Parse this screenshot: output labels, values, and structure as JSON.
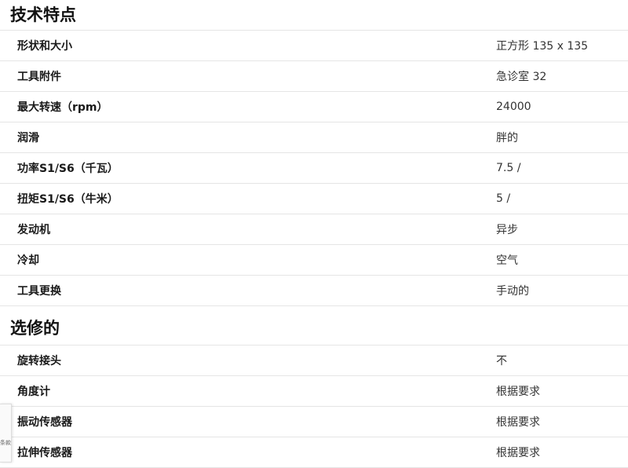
{
  "sections": [
    {
      "title": "技术特点",
      "rows": [
        {
          "label": "形状和大小",
          "value": "正方形 135 x 135"
        },
        {
          "label": "工具附件",
          "value": "急诊室 32"
        },
        {
          "label": "最大转速（rpm）",
          "value": "24000"
        },
        {
          "label": "润滑",
          "value": "胖的"
        },
        {
          "label": "功率S1/S6（千瓦）",
          "value": "7.5 /"
        },
        {
          "label": "扭矩S1/S6（牛米）",
          "value": "5 /"
        },
        {
          "label": "发动机",
          "value": "异步"
        },
        {
          "label": "冷却",
          "value": "空气"
        },
        {
          "label": "工具更换",
          "value": "手动的"
        }
      ]
    },
    {
      "title": "选修的",
      "rows": [
        {
          "label": "旋转接头",
          "value": "不"
        },
        {
          "label": "角度计",
          "value": "根据要求"
        },
        {
          "label": "振动传感器",
          "value": "根据要求"
        },
        {
          "label": "拉伸传感器",
          "value": "根据要求"
        }
      ]
    }
  ],
  "side_widget": {
    "label": "条款"
  }
}
